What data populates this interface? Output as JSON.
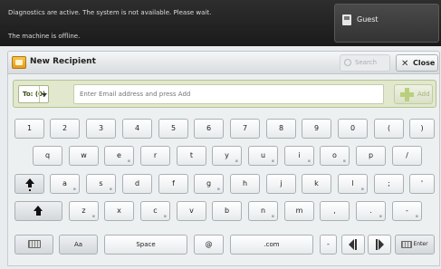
{
  "status": {
    "message_line1": "Diagnostics are active. The system is not available. Please wait.",
    "message_line2": "The machine is offline."
  },
  "user": {
    "name": "Guest",
    "icon": "user-card-icon"
  },
  "title_bar": {
    "title": "New Recipient",
    "search_label": "Search",
    "close_label": "Close"
  },
  "address": {
    "to_label": "To: (0)",
    "input_placeholder": "Enter Email address and press Add",
    "input_value": "",
    "add_label": "Add"
  },
  "keyboard": {
    "row1": [
      {
        "label": "1"
      },
      {
        "label": "2"
      },
      {
        "label": "3"
      },
      {
        "label": "4"
      },
      {
        "label": "5"
      },
      {
        "label": "6"
      },
      {
        "label": "7"
      },
      {
        "label": "8"
      },
      {
        "label": "9"
      },
      {
        "label": "0"
      },
      {
        "label": "("
      },
      {
        "label": ")"
      }
    ],
    "row2": [
      {
        "label": "q"
      },
      {
        "label": "w"
      },
      {
        "label": "e"
      },
      {
        "label": "r"
      },
      {
        "label": "t"
      },
      {
        "label": "y"
      },
      {
        "label": "u"
      },
      {
        "label": "i"
      },
      {
        "label": "o"
      },
      {
        "label": "p"
      },
      {
        "label": "/"
      }
    ],
    "row3": [
      {
        "label": "a"
      },
      {
        "label": "s"
      },
      {
        "label": "d"
      },
      {
        "label": "f"
      },
      {
        "label": "g"
      },
      {
        "label": "h"
      },
      {
        "label": "j"
      },
      {
        "label": "k"
      },
      {
        "label": "l"
      },
      {
        "label": ";"
      },
      {
        "label": "'"
      }
    ],
    "row4": [
      {
        "label": "z"
      },
      {
        "label": "x"
      },
      {
        "label": "c"
      },
      {
        "label": "v"
      },
      {
        "label": "b"
      },
      {
        "label": "n"
      },
      {
        "label": "m"
      },
      {
        "label": ","
      },
      {
        "label": "."
      },
      {
        "label": "-"
      }
    ],
    "space_label": "Space",
    "at_label": "@",
    "com_label": ".com",
    "dash_label": "-",
    "abc_label": "Aa",
    "enter_label": "Enter"
  },
  "colors": {
    "accent_green": "#b5c48e",
    "banner_bg": "#1f1f1f"
  }
}
